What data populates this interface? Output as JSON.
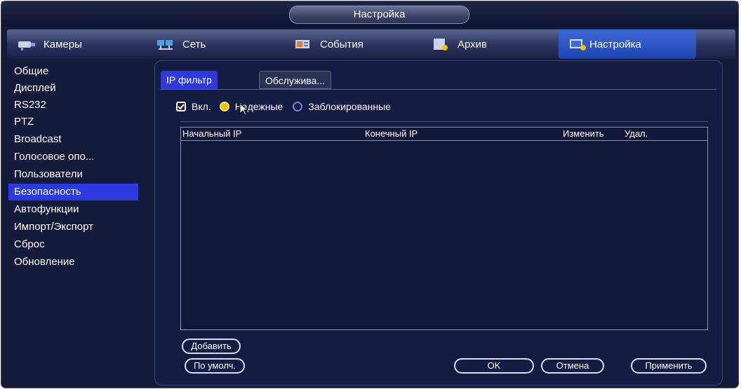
{
  "window": {
    "title": "Настройка"
  },
  "topnav": {
    "tabs": [
      {
        "label": "Камеры",
        "icon": "camera-icon"
      },
      {
        "label": "Сеть",
        "icon": "network-icon"
      },
      {
        "label": "События",
        "icon": "events-icon"
      },
      {
        "label": "Архив",
        "icon": "archive-icon"
      },
      {
        "label": "Настройка",
        "icon": "settings-icon",
        "active": true
      }
    ]
  },
  "sidebar": {
    "items": [
      {
        "label": "Общие"
      },
      {
        "label": "Дисплей"
      },
      {
        "label": "RS232"
      },
      {
        "label": "PTZ"
      },
      {
        "label": "Broadcast"
      },
      {
        "label": "Голосовое опо..."
      },
      {
        "label": "Пользователи"
      },
      {
        "label": "Безопасность",
        "active": true
      },
      {
        "label": "Автофункции"
      },
      {
        "label": "Импорт/Экспорт"
      },
      {
        "label": "Сброс"
      },
      {
        "label": "Обновление"
      }
    ]
  },
  "subtabs": [
    {
      "label": "IP фильтр",
      "active": true
    },
    {
      "label": "Обслужива..."
    }
  ],
  "options": {
    "enable_label": "Вкл.",
    "enable_checked": true,
    "trusted_label": "Надежные",
    "trusted_selected": true,
    "blocked_label": "Заблокированные",
    "blocked_selected": false
  },
  "table": {
    "columns": [
      "Начальный IP",
      "Конечный IP",
      "Изменить",
      "Удал."
    ],
    "rows": []
  },
  "buttons": {
    "add": "Добавить",
    "default": "По умолч.",
    "ok": "OK",
    "cancel": "Отмена",
    "apply": "Применить"
  },
  "colors": {
    "background": "#141a3a",
    "accent": "#2c3adf",
    "radio_selected": "#f2c400"
  }
}
